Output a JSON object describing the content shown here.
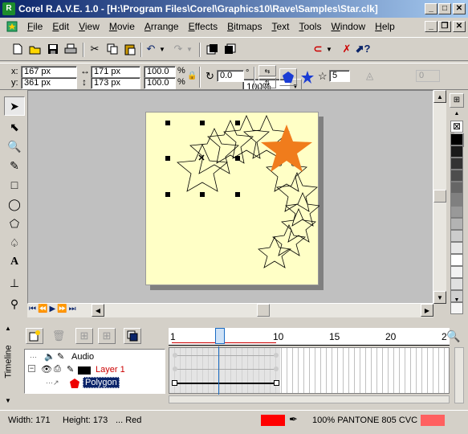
{
  "window": {
    "title": "Corel R.A.V.E. 1.0 - [H:\\Program Files\\Corel\\Graphics10\\Rave\\Samples\\Star.clk]",
    "app_icon": "rave-app-icon",
    "minimize": "_",
    "maximize": "□",
    "close": "✕",
    "doc_minimize": "_",
    "doc_restore": "❐",
    "doc_close": "✕"
  },
  "menu": {
    "doc_icon": "document-icon",
    "items": [
      "File",
      "Edit",
      "View",
      "Movie",
      "Arrange",
      "Effects",
      "Bitmaps",
      "Text",
      "Tools",
      "Window",
      "Help"
    ]
  },
  "standard_toolbar": {
    "zoom_value": "100%",
    "icons": [
      "new-icon",
      "open-icon",
      "save-icon",
      "print-icon",
      "cut-icon",
      "copy-icon",
      "paste-icon",
      "undo-icon",
      "redo-icon",
      "import-icon",
      "export-icon",
      "zoom-select",
      "snap-icon",
      "align-icon",
      "launcher-icon",
      "options-icon",
      "whats-this-icon"
    ]
  },
  "property_bar": {
    "x_label": "x:",
    "x_value": "167 px",
    "y_label": "y:",
    "y_value": "361 px",
    "width_value": "171 px",
    "height_value": "173 px",
    "scale_x": "100.0",
    "scale_y": "100.0",
    "percent": "%",
    "rotation_value": "0.0",
    "degree": "°",
    "points_value": "5",
    "sharpness_value": "0"
  },
  "toolbox": {
    "tools": [
      "pick-tool-icon",
      "shape-tool-icon",
      "zoom-tool-icon",
      "freehand-tool-icon",
      "rectangle-tool-icon",
      "ellipse-tool-icon",
      "polygon-tool-icon",
      "basic-shapes-tool-icon",
      "text-tool-icon",
      "interactive-tool-icon",
      "eyedropper-tool-icon"
    ]
  },
  "playback": {
    "buttons": [
      "first-frame-icon",
      "prev-frame-icon",
      "play-icon",
      "next-frame-icon",
      "last-frame-icon"
    ]
  },
  "palette": {
    "colors": [
      "#ffffff",
      "#000000",
      "#1a1a1a",
      "#333333",
      "#4d4d4d",
      "#666666",
      "#808080",
      "#999999",
      "#b3b3b3",
      "#cccccc",
      "#e6e6e6",
      "#ffffff",
      "#f2f2f2",
      "#e0e0e0",
      "#d0d0d0",
      "#f5f5f5"
    ],
    "accent_star": "#f07c1c",
    "selected_fill": "#ff0000"
  },
  "timeline": {
    "label": "Timeline",
    "frame_numbers": [
      "1",
      "5",
      "10",
      "15",
      "20",
      "2"
    ],
    "current_frame": "5",
    "tracks": [
      {
        "name": "Audio",
        "icon": "speaker-icon",
        "selected": false,
        "color": "#000000"
      },
      {
        "name": "Layer 1",
        "icon": "layer-icon",
        "selected": false,
        "color": "#cc0000"
      },
      {
        "name": "Polygon",
        "icon": "polygon-icon",
        "selected": true,
        "color": "#ffffff"
      }
    ]
  },
  "status": {
    "width_text": "Width: 171",
    "height_text": "Height: 173",
    "fill_text": "... Red",
    "pantone_text": "100% PANTONE 805 CVC",
    "fill_color": "#ff0000",
    "outline_color": "#ff6060"
  }
}
